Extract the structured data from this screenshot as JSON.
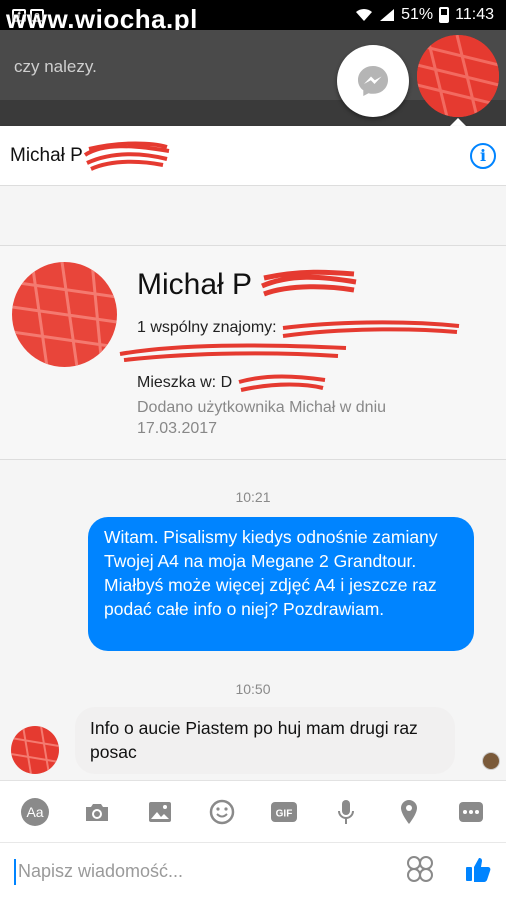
{
  "status_bar": {
    "watermark": "www.wiocha.pl",
    "battery": "51%",
    "time": "11:43"
  },
  "background": {
    "text": "czy nalezy."
  },
  "chat": {
    "contact_name": "Michał P",
    "profile": {
      "name": "Michał P",
      "mutual": "1 wspólny znajomy:",
      "lives_in": "Mieszka w: D",
      "added": "Dodano użytkownika Michał w dniu 17.03.2017"
    },
    "messages": [
      {
        "time": "10:21",
        "direction": "out",
        "text": "Witam. Pisalismy kiedys odnośnie zamiany Twojej A4 na moja Megane 2 Grandtour. Miałbyś może więcej zdjęć A4 i jeszcze raz podać całe info o niej? Pozdrawiam."
      },
      {
        "time": "10:50",
        "direction": "in",
        "text": "Info o aucie Piastem po huj mam drugi raz posac"
      }
    ]
  },
  "toolbar": {
    "items": [
      "aa-icon",
      "camera-icon",
      "gallery-icon",
      "emoji-icon",
      "gif-icon",
      "microphone-icon",
      "location-icon",
      "more-icon"
    ],
    "gif_label": "GIF",
    "aa_label": "Aa"
  },
  "composer": {
    "placeholder": "Napisz wiadomość..."
  },
  "colors": {
    "accent": "#0084ff",
    "redaction": "#e53a30"
  }
}
